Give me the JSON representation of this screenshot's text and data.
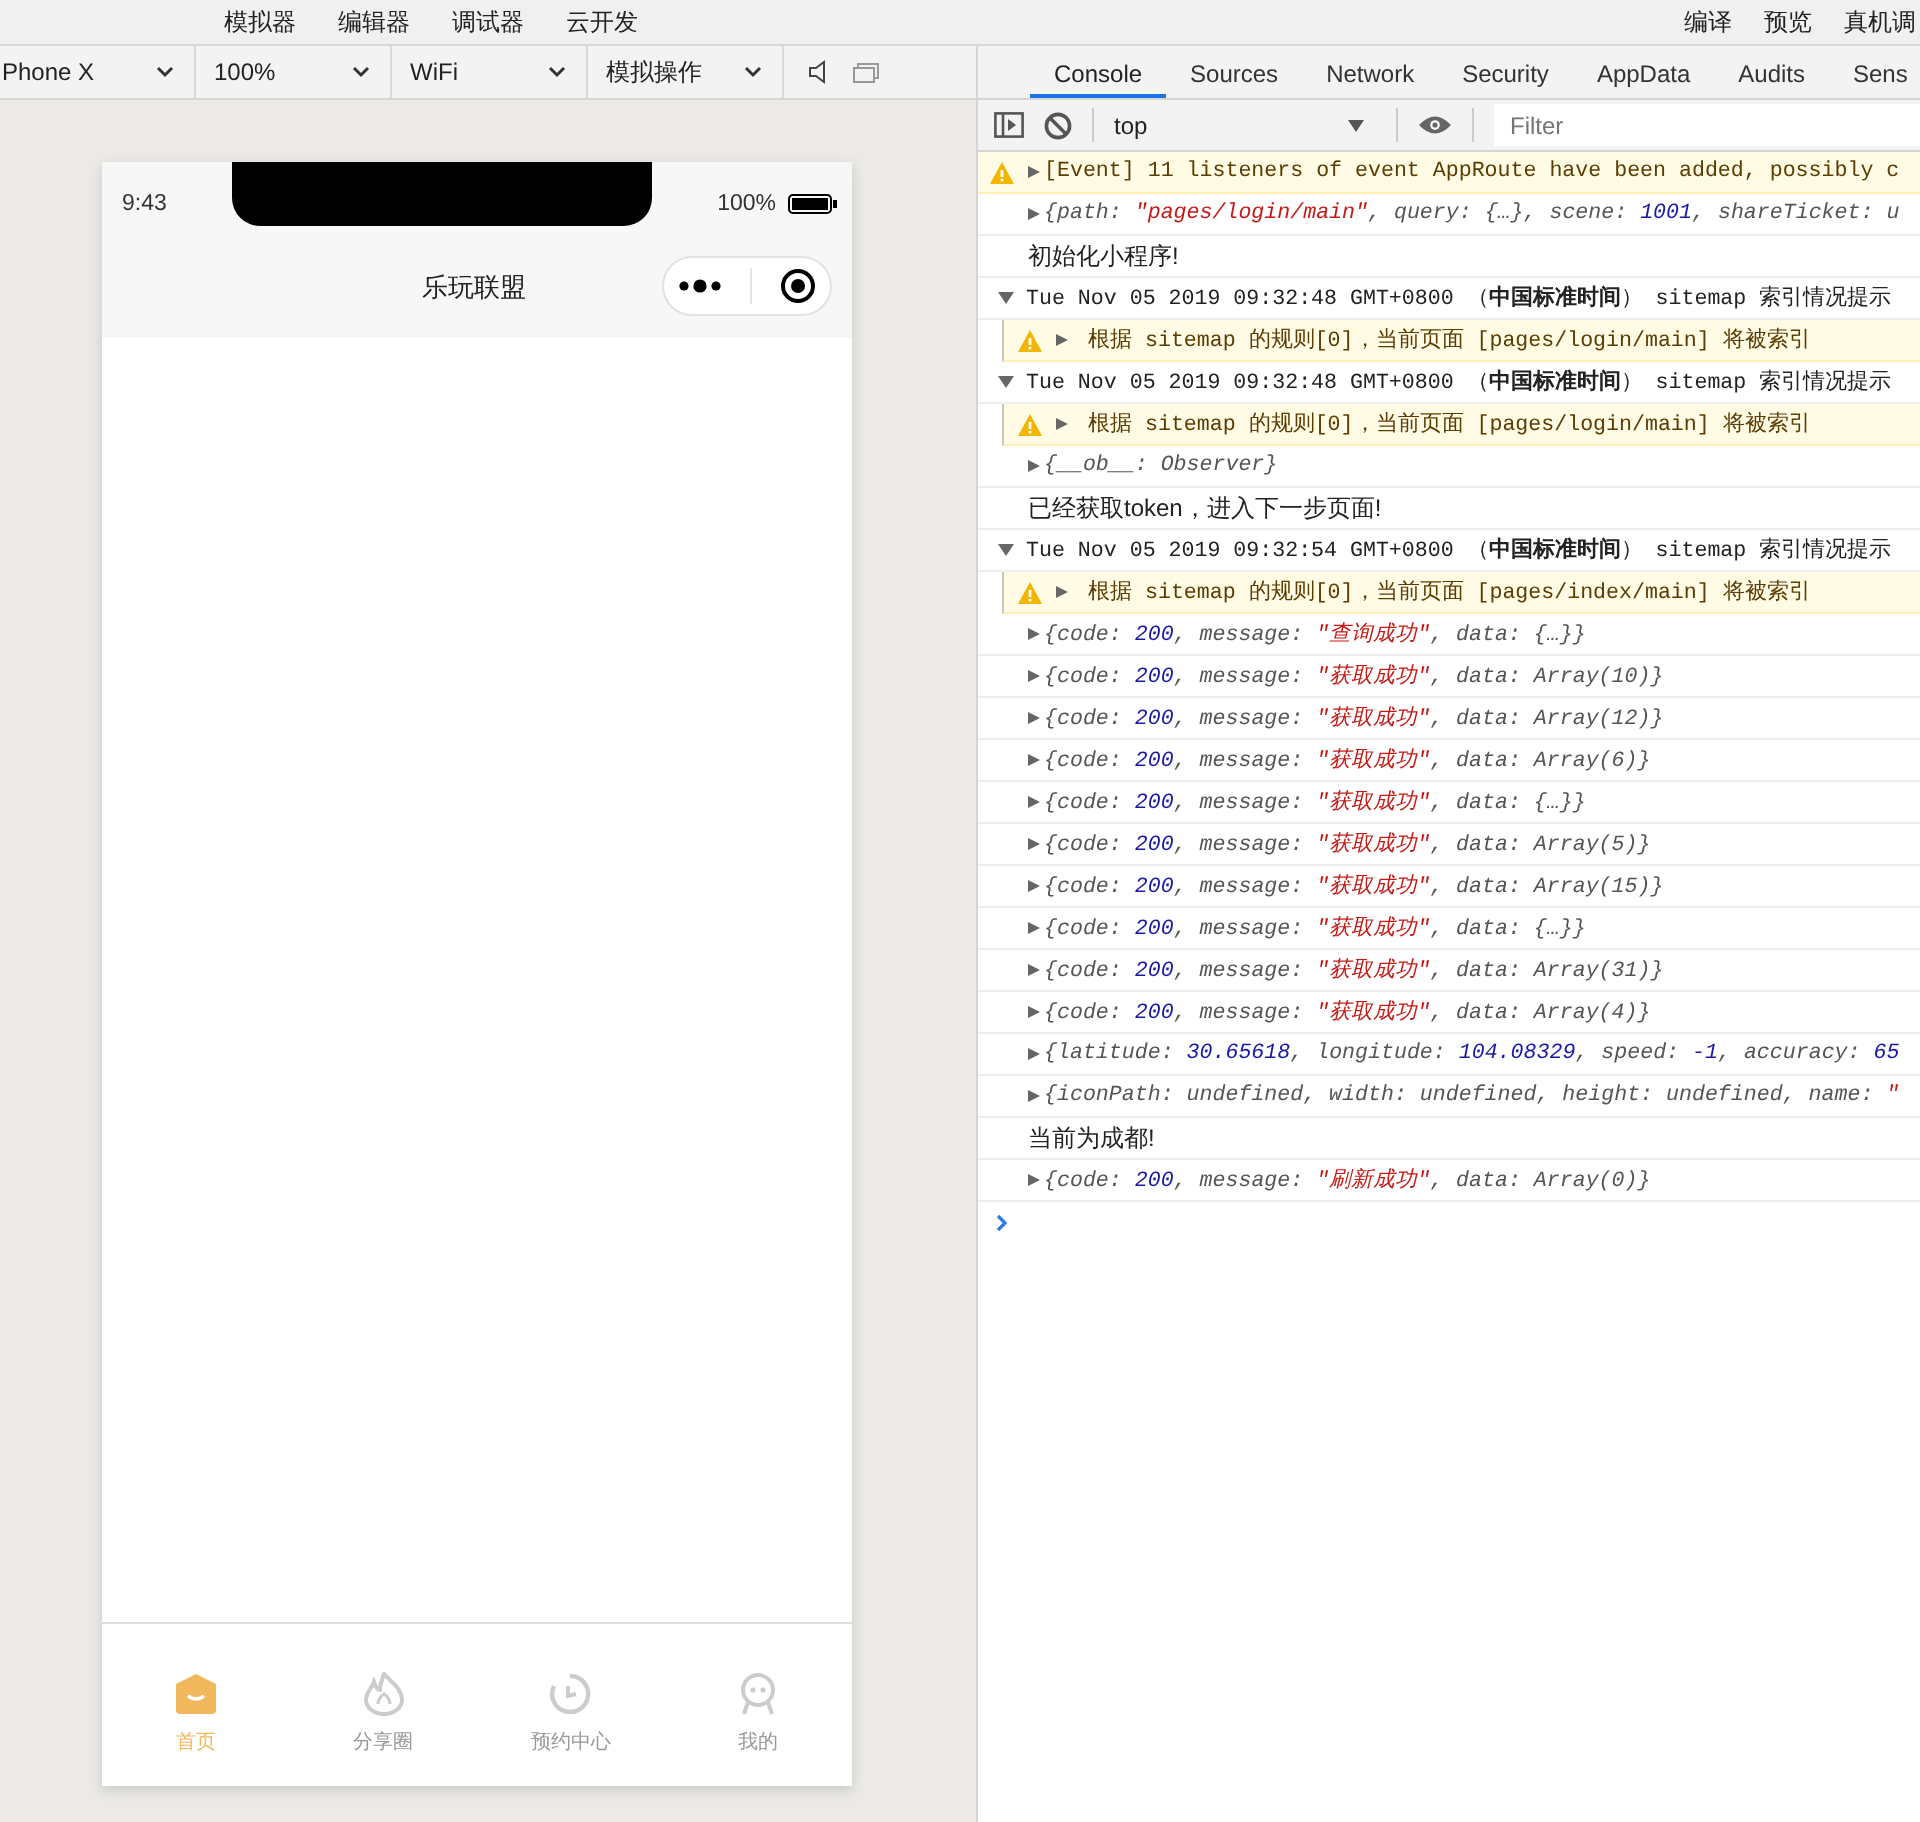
{
  "menu": {
    "left": [
      "模拟器",
      "编辑器",
      "调试器",
      "云开发"
    ],
    "right": [
      "编译",
      "预览",
      "真机调"
    ]
  },
  "sim_toolbar": {
    "selects": [
      "Phone X",
      "100%",
      "WiFi",
      "模拟操作"
    ]
  },
  "phone": {
    "time": "9:43",
    "battery": "100%",
    "title": "乐玩联盟",
    "tabbar": [
      {
        "label": "首页",
        "kind": "home",
        "selected": true
      },
      {
        "label": "分享圈",
        "kind": "flame",
        "selected": false
      },
      {
        "label": "预约中心",
        "kind": "clock",
        "selected": false
      },
      {
        "label": "我的",
        "kind": "face",
        "selected": false
      }
    ]
  },
  "devtools": {
    "tabs": [
      {
        "label": "Console",
        "selected": true
      },
      {
        "label": "Sources",
        "selected": false
      },
      {
        "label": "Network",
        "selected": false
      },
      {
        "label": "Security",
        "selected": false
      },
      {
        "label": "AppData",
        "selected": false
      },
      {
        "label": "Audits",
        "selected": false
      },
      {
        "label": "Sens",
        "selected": false
      }
    ],
    "context": "top",
    "filter": {
      "placeholder": "Filter"
    },
    "console": [
      {
        "kind": "warning",
        "expanded": false,
        "text": "[Event] 11 listeners of event AppRoute have been added, possibly c"
      },
      {
        "kind": "object",
        "expanded": false,
        "segments": [
          {
            "t": "{path: ",
            "kind": "plain"
          },
          {
            "t": "\"pages/login/main\"",
            "kind": "string"
          },
          {
            "t": ", query: {…}, scene: ",
            "kind": "plain"
          },
          {
            "t": "1001",
            "kind": "number"
          },
          {
            "t": ", shareTicket: u",
            "kind": "plain"
          }
        ]
      },
      {
        "kind": "log",
        "text": "初始化小程序!"
      },
      {
        "kind": "group",
        "expanded": true,
        "text": "Tue Nov 05 2019 09:32:48 GMT+0800 （**中国标准时间**） sitemap 索引情况提示",
        "children": [
          {
            "kind": "warning",
            "expanded": false,
            "text": "根据 sitemap 的规则[0]，当前页面 [pages/login/main] 将被索引"
          }
        ]
      },
      {
        "kind": "group",
        "expanded": true,
        "text": "Tue Nov 05 2019 09:32:48 GMT+0800 （**中国标准时间**） sitemap 索引情况提示",
        "children": [
          {
            "kind": "warning",
            "expanded": false,
            "text": "根据 sitemap 的规则[0]，当前页面 [pages/login/main] 将被索引"
          }
        ]
      },
      {
        "kind": "object",
        "expanded": false,
        "segments": [
          {
            "t": "{__ob__: Observer}",
            "kind": "plain"
          }
        ]
      },
      {
        "kind": "log",
        "text": "已经获取token，进入下一步页面!"
      },
      {
        "kind": "group",
        "expanded": true,
        "text": "Tue Nov 05 2019 09:32:54 GMT+0800 （**中国标准时间**） sitemap 索引情况提示",
        "children": [
          {
            "kind": "warning",
            "expanded": false,
            "text": "根据 sitemap 的规则[0]，当前页面 [pages/index/main] 将被索引"
          }
        ]
      },
      {
        "kind": "object",
        "expanded": false,
        "segments": [
          {
            "t": "{code: ",
            "kind": "plain"
          },
          {
            "t": "200",
            "kind": "number"
          },
          {
            "t": ", message: ",
            "kind": "plain"
          },
          {
            "t": "\"查询成功\"",
            "kind": "string"
          },
          {
            "t": ", data: {…}}",
            "kind": "plain"
          }
        ]
      },
      {
        "kind": "object",
        "expanded": false,
        "segments": [
          {
            "t": "{code: ",
            "kind": "plain"
          },
          {
            "t": "200",
            "kind": "number"
          },
          {
            "t": ", message: ",
            "kind": "plain"
          },
          {
            "t": "\"获取成功\"",
            "kind": "string"
          },
          {
            "t": ", data: Array(10)}",
            "kind": "plain"
          }
        ]
      },
      {
        "kind": "object",
        "expanded": false,
        "segments": [
          {
            "t": "{code: ",
            "kind": "plain"
          },
          {
            "t": "200",
            "kind": "number"
          },
          {
            "t": ", message: ",
            "kind": "plain"
          },
          {
            "t": "\"获取成功\"",
            "kind": "string"
          },
          {
            "t": ", data: Array(12)}",
            "kind": "plain"
          }
        ]
      },
      {
        "kind": "object",
        "expanded": false,
        "segments": [
          {
            "t": "{code: ",
            "kind": "plain"
          },
          {
            "t": "200",
            "kind": "number"
          },
          {
            "t": ", message: ",
            "kind": "plain"
          },
          {
            "t": "\"获取成功\"",
            "kind": "string"
          },
          {
            "t": ", data: Array(6)}",
            "kind": "plain"
          }
        ]
      },
      {
        "kind": "object",
        "expanded": false,
        "segments": [
          {
            "t": "{code: ",
            "kind": "plain"
          },
          {
            "t": "200",
            "kind": "number"
          },
          {
            "t": ", message: ",
            "kind": "plain"
          },
          {
            "t": "\"获取成功\"",
            "kind": "string"
          },
          {
            "t": ", data: {…}}",
            "kind": "plain"
          }
        ]
      },
      {
        "kind": "object",
        "expanded": false,
        "segments": [
          {
            "t": "{code: ",
            "kind": "plain"
          },
          {
            "t": "200",
            "kind": "number"
          },
          {
            "t": ", message: ",
            "kind": "plain"
          },
          {
            "t": "\"获取成功\"",
            "kind": "string"
          },
          {
            "t": ", data: Array(5)}",
            "kind": "plain"
          }
        ]
      },
      {
        "kind": "object",
        "expanded": false,
        "segments": [
          {
            "t": "{code: ",
            "kind": "plain"
          },
          {
            "t": "200",
            "kind": "number"
          },
          {
            "t": ", message: ",
            "kind": "plain"
          },
          {
            "t": "\"获取成功\"",
            "kind": "string"
          },
          {
            "t": ", data: Array(15)}",
            "kind": "plain"
          }
        ]
      },
      {
        "kind": "object",
        "expanded": false,
        "segments": [
          {
            "t": "{code: ",
            "kind": "plain"
          },
          {
            "t": "200",
            "kind": "number"
          },
          {
            "t": ", message: ",
            "kind": "plain"
          },
          {
            "t": "\"获取成功\"",
            "kind": "string"
          },
          {
            "t": ", data: {…}}",
            "kind": "plain"
          }
        ]
      },
      {
        "kind": "object",
        "expanded": false,
        "segments": [
          {
            "t": "{code: ",
            "kind": "plain"
          },
          {
            "t": "200",
            "kind": "number"
          },
          {
            "t": ", message: ",
            "kind": "plain"
          },
          {
            "t": "\"获取成功\"",
            "kind": "string"
          },
          {
            "t": ", data: Array(31)}",
            "kind": "plain"
          }
        ]
      },
      {
        "kind": "object",
        "expanded": false,
        "segments": [
          {
            "t": "{code: ",
            "kind": "plain"
          },
          {
            "t": "200",
            "kind": "number"
          },
          {
            "t": ", message: ",
            "kind": "plain"
          },
          {
            "t": "\"获取成功\"",
            "kind": "string"
          },
          {
            "t": ", data: Array(4)}",
            "kind": "plain"
          }
        ]
      },
      {
        "kind": "object",
        "expanded": false,
        "segments": [
          {
            "t": "{latitude: ",
            "kind": "plain"
          },
          {
            "t": "30.65618",
            "kind": "number"
          },
          {
            "t": ", longitude: ",
            "kind": "plain"
          },
          {
            "t": "104.08329",
            "kind": "number"
          },
          {
            "t": ", speed: ",
            "kind": "plain"
          },
          {
            "t": "-1",
            "kind": "number"
          },
          {
            "t": ", accuracy: ",
            "kind": "plain"
          },
          {
            "t": "65",
            "kind": "number"
          }
        ]
      },
      {
        "kind": "object",
        "expanded": false,
        "segments": [
          {
            "t": "{iconPath: undefined, width: undefined, height: undefined, name: ",
            "kind": "plain"
          },
          {
            "t": "\"",
            "kind": "string"
          }
        ]
      },
      {
        "kind": "log",
        "text": "当前为成都!"
      },
      {
        "kind": "object",
        "expanded": false,
        "segments": [
          {
            "t": "{code: ",
            "kind": "plain"
          },
          {
            "t": "200",
            "kind": "number"
          },
          {
            "t": ", message: ",
            "kind": "plain"
          },
          {
            "t": "\"刷新成功\"",
            "kind": "string"
          },
          {
            "t": ", data: Array(0)}",
            "kind": "plain"
          }
        ]
      }
    ]
  }
}
